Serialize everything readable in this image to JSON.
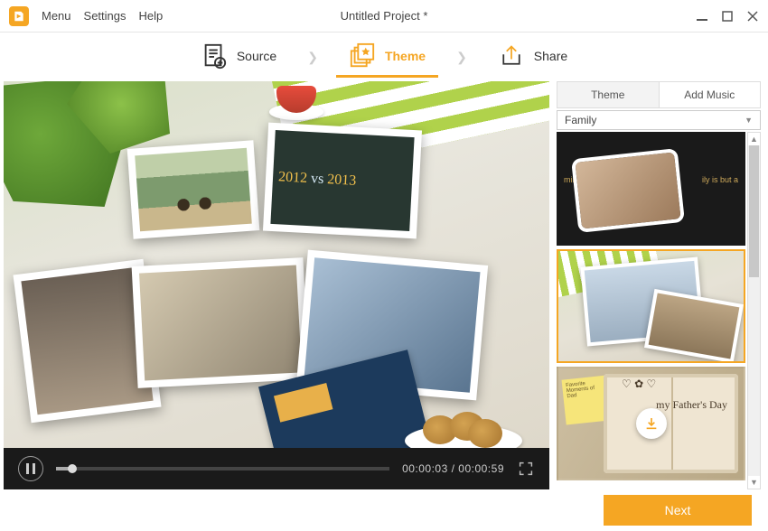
{
  "app": {
    "title": "Untitled Project *",
    "menu": [
      "Menu",
      "Settings",
      "Help"
    ]
  },
  "steps": {
    "source": "Source",
    "theme": "Theme",
    "share": "Share",
    "active": "theme"
  },
  "preview": {
    "chalkboard": {
      "year1": "2012",
      "year2": "2013",
      "word": "vs"
    }
  },
  "player": {
    "state": "playing",
    "current_time": "00:00:03",
    "total_time": "00:00:59",
    "time_display": "00:00:03 / 00:00:59",
    "progress_pct": 5
  },
  "side": {
    "tabs": {
      "theme": "Theme",
      "music": "Add Music",
      "active": "music"
    },
    "category": "Family",
    "themes": [
      {
        "id": "family-quote",
        "caption_left": "mily is but a",
        "caption_right": "ily is but a",
        "selected": false,
        "downloadable": false
      },
      {
        "id": "family-collage",
        "selected": true,
        "downloadable": false
      },
      {
        "id": "fathers-day",
        "note_text": "Favorite\nMoments of Dad",
        "title_text": "my Father's\nDay",
        "selected": false,
        "downloadable": true
      }
    ]
  },
  "footer": {
    "next": "Next"
  },
  "colors": {
    "accent": "#f5a623"
  }
}
